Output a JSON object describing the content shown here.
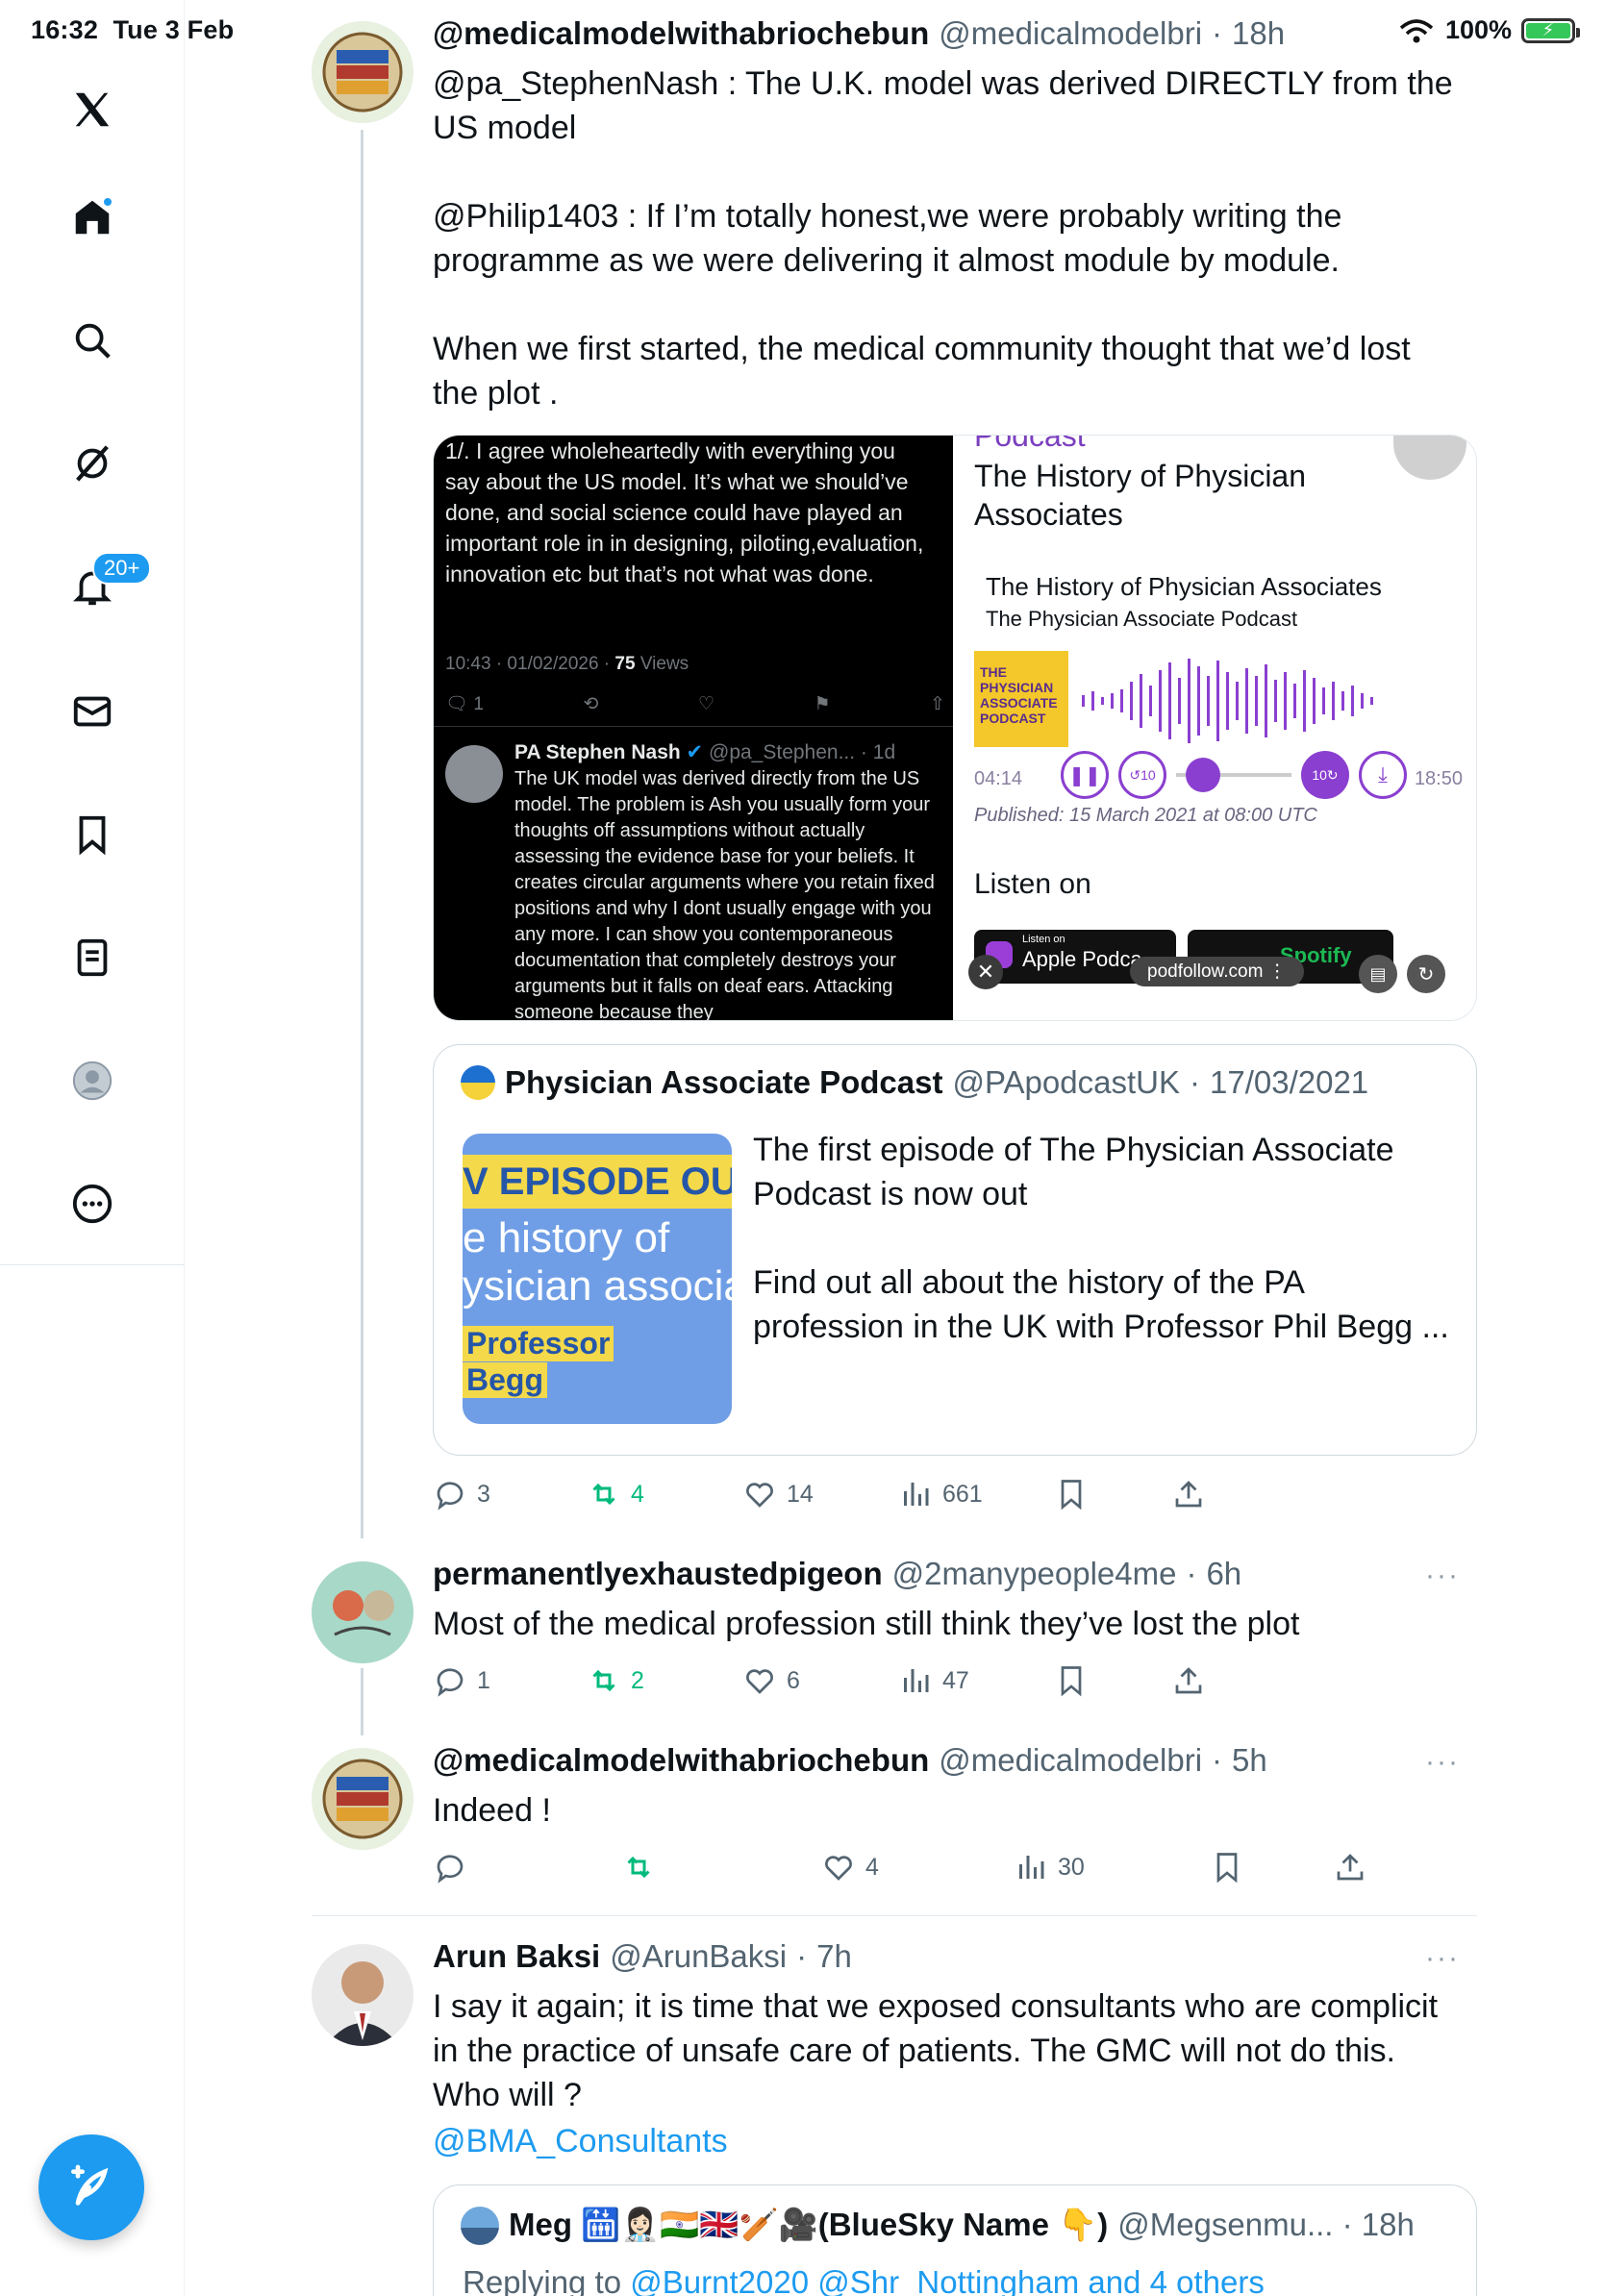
{
  "status": {
    "time": "16:32",
    "date": "Tue 3 Feb",
    "battery": "100%"
  },
  "sidebar": {
    "notifications_badge": "20+",
    "items": [
      "x-logo",
      "home",
      "search",
      "grok",
      "notifications",
      "messages",
      "bookmarks",
      "lists",
      "profile",
      "more"
    ]
  },
  "tweet1": {
    "name": "@medicalmodelwithabriochebun",
    "handle": "@medicalmodelbri",
    "time": "18h",
    "text": "@pa_StephenNash : The U.K. model was derived DIRECTLY from the US model\n\n@Philip1403 : If I’m totally honest,we were probably writing the programme as we were delivering it almost module by module.\n\nWhen we first started, the medical community thought that we’d lost the plot .",
    "media_left": {
      "top_text": "1/. I agree wholeheartedly with everything you say about the US model. It’s what we should’ve done, and social science could have played an important role in in designing, piloting,evaluation, innovation etc but that’s not what was done.",
      "meta": "10:43 · 01/02/2026 · ",
      "views": "75",
      "views_label": " Views",
      "reply_count": "1",
      "reply_name": "PA Stephen Nash",
      "reply_handle": "@pa_Stephen... · 1d",
      "reply_text": "The UK model was derived directly from the US model. The problem is Ash you usually form your thoughts off assumptions without actually assessing the evidence base for your beliefs. It creates circular arguments where you retain fixed positions and why I dont usually engage with you any more. I can show you contemporaneous documentation that completely destroys your arguments but it falls on deaf ears. Attacking someone because they"
    },
    "media_right": {
      "cut_heading": "Podcast",
      "title": "The History of Physician Associates",
      "episode_title": "The History of Physician Associates",
      "podcast_name": "The Physician Associate Podcast",
      "cover_text": "THE PHYSICIAN ASSOCIATE PODCAST",
      "time_start": "04:14",
      "time_end": "18:50",
      "published": "Published: 15 March 2021 at 08:00 UTC",
      "listen_on": "Listen on",
      "apple_small": "Listen on",
      "apple": "Apple Podca",
      "spotify": "Spotify",
      "url": "podfollow.com"
    },
    "quote": {
      "name": "Physician Associate Podcast",
      "handle": "@PApodcastUK",
      "date": "17/03/2021",
      "thumb_line1": "V EPISODE OUT NOW",
      "thumb_line2": "e history of",
      "thumb_line3": "ysician associate",
      "thumb_line4": "Professor",
      "thumb_line5": "Begg",
      "text": "The first episode of The Physician Associate Podcast is now out\n\nFind out all about the history of the PA profession in the UK with Professor Phil Begg ..."
    },
    "replies": "3",
    "reposts": "4",
    "likes": "14",
    "views": "661"
  },
  "tweet2": {
    "name": "permanentlyexhaustedpigeon",
    "handle": "@2manypeople4me",
    "time": "6h",
    "text": "Most of the medical profession still think they’ve lost the plot",
    "replies": "1",
    "reposts": "2",
    "likes": "6",
    "views": "47"
  },
  "tweet3": {
    "name": "@medicalmodelwithabriochebun",
    "handle": "@medicalmodelbri",
    "time": "5h",
    "text": "Indeed !",
    "likes": "4",
    "views": "30"
  },
  "tweet4": {
    "name": "Arun Baksi",
    "handle": "@ArunBaksi",
    "time": "7h",
    "text": "I say it again; it is time that we exposed consultants who are complicit in the practice of unsafe care of patients. The GMC will not do this. Who will ?",
    "mention": "@BMA_Consultants",
    "quote_name": "Meg 🛗👩🏻‍⚕️🇮🇳🇬🇧🏏🎥(BlueSky Name 👇)",
    "quote_handle": "@Megsenmu... · 18h",
    "quote_reply": "Replying to ",
    "quote_reply_links": "@Burnt2020 @Shr_Nottingham and 4 others"
  },
  "colors": {
    "accent": "#1d9bf0",
    "repost": "#00ba7c",
    "text": "#0f1419",
    "muted": "#536471"
  }
}
